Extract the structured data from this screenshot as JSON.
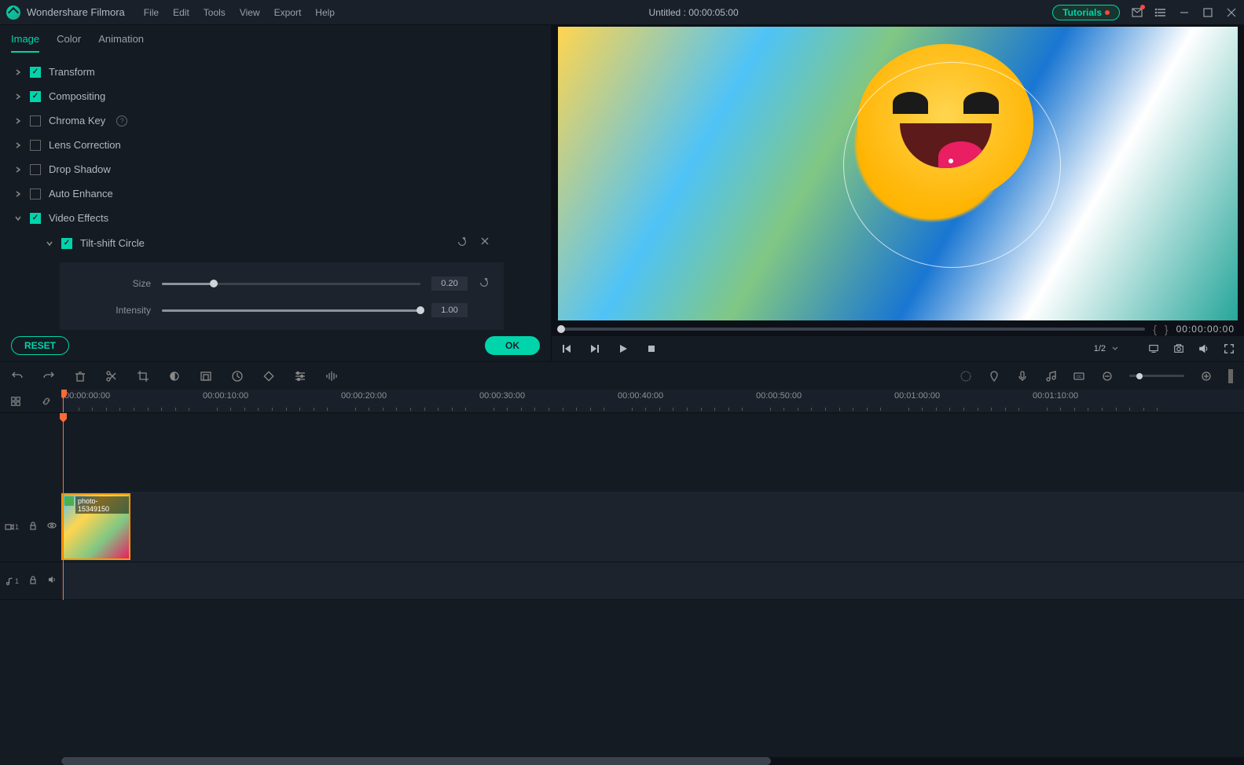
{
  "app": {
    "name": "Wondershare Filmora"
  },
  "menu": [
    "File",
    "Edit",
    "Tools",
    "View",
    "Export",
    "Help"
  ],
  "title": "Untitled : 00:00:05:00",
  "tutorials": "Tutorials",
  "tabs": {
    "items": [
      "Image",
      "Color",
      "Animation"
    ],
    "active": 0
  },
  "props": [
    {
      "label": "Transform",
      "checked": true,
      "expanded": false
    },
    {
      "label": "Compositing",
      "checked": true,
      "expanded": false
    },
    {
      "label": "Chroma Key",
      "checked": false,
      "expanded": false,
      "help": true
    },
    {
      "label": "Lens Correction",
      "checked": false,
      "expanded": false
    },
    {
      "label": "Drop Shadow",
      "checked": false,
      "expanded": false
    },
    {
      "label": "Auto Enhance",
      "checked": false,
      "expanded": false
    },
    {
      "label": "Video Effects",
      "checked": true,
      "expanded": true
    }
  ],
  "effect": {
    "name": "Tilt-shift Circle",
    "checked": true,
    "sliders": [
      {
        "label": "Size",
        "value": "0.20",
        "pct": 20
      },
      {
        "label": "Intensity",
        "value": "1.00",
        "pct": 100
      }
    ]
  },
  "buttons": {
    "reset": "RESET",
    "ok": "OK"
  },
  "preview": {
    "timecode": "00:00:00:00",
    "quality": "1/2"
  },
  "ruler": [
    "00:00:00:00",
    "00:00:10:00",
    "00:00:20:00",
    "00:00:30:00",
    "00:00:40:00",
    "00:00:50:00",
    "00:01:00:00",
    "00:01:10:00"
  ],
  "clip": {
    "label": "photo-15349150"
  },
  "track": {
    "video": "1",
    "audio": "1"
  }
}
